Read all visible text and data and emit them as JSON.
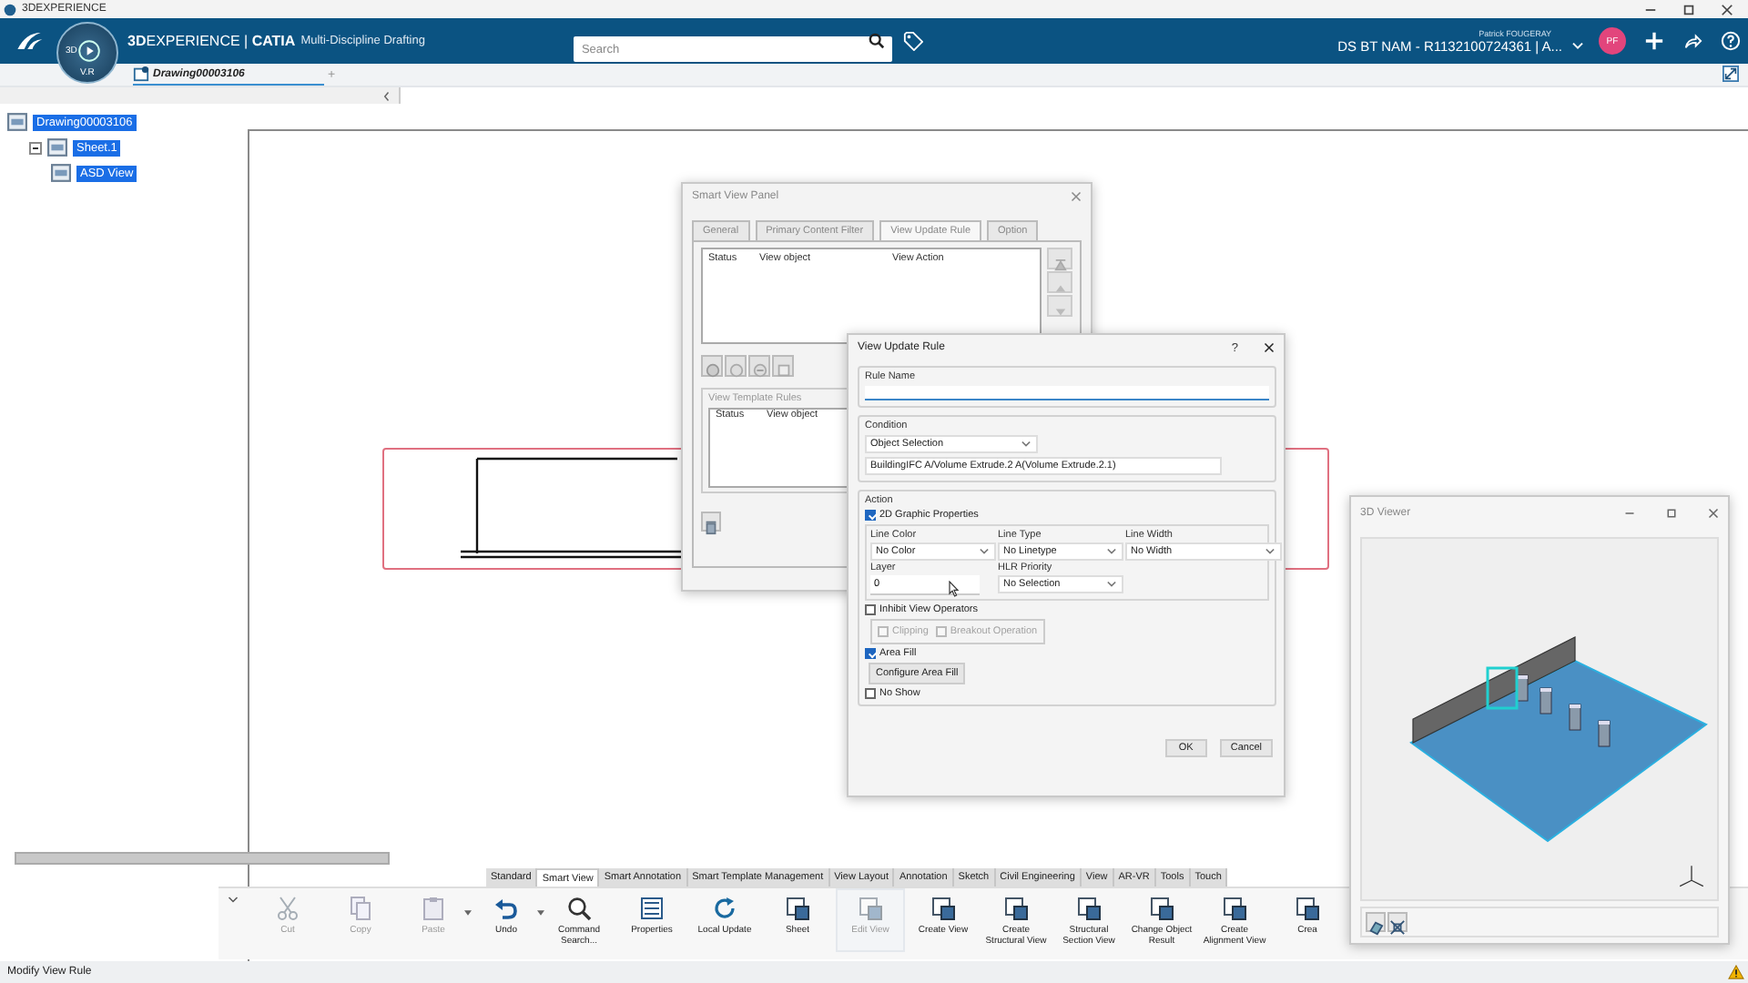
{
  "title_bar": {
    "title": "3DEXPERIENCE"
  },
  "top_bar": {
    "brand": "**3D**EXPERIENCE | **CATIA**",
    "role": "Multi-Discipline Drafting",
    "compass": [
      "3D",
      "V.R"
    ],
    "search": {
      "placeholder": "Search"
    },
    "user": "Patrick FOUGERAY",
    "tenant": "DS BT NAM - R1132100724361 | A...",
    "avatar": "PF"
  },
  "doc_tabs": [
    {
      "label": "Drawing00003106",
      "selected": true
    }
  ],
  "add_tab": "+",
  "tree": [
    {
      "label": "Drawing00003106",
      "selected": true,
      "children": [
        {
          "label": "Sheet.1",
          "selected": true,
          "expanded": true,
          "children": [
            {
              "label": "ASD View",
              "selected": true
            }
          ]
        }
      ]
    }
  ],
  "smart_view_panel": {
    "title": "Smart View Panel",
    "tabs": [
      {
        "label": "General",
        "selected": false
      },
      {
        "label": "Primary Content Filter",
        "selected": false
      },
      {
        "label": "View Update Rule",
        "selected": true
      },
      {
        "label": "Option",
        "selected": false
      }
    ],
    "rule_columns": [
      "Status",
      "View object",
      "View Action"
    ],
    "template_rules": {
      "title": "View Template Rules",
      "columns": [
        "Status",
        "View object"
      ]
    }
  },
  "rule_dialog": {
    "title": "View Update Rule",
    "help": "?",
    "rule_name": "Rule Name",
    "condition": {
      "title": "Condition",
      "selection": "Object Selection",
      "objects": "BuildingIFC A/Volume Extrude.2 A(Volume Extrude.2.1)"
    },
    "action": {
      "title": "Action",
      "graphic_properties": {
        "label": "2D Graphic Properties",
        "checked": true
      },
      "fields": [
        {
          "label": "Line Color",
          "kind": "dropdown",
          "value": "No Color"
        },
        {
          "label": "Line Type",
          "kind": "dropdown",
          "value": "No Linetype"
        },
        {
          "label": "Line Width",
          "kind": "dropdown",
          "value": "No Width"
        },
        {
          "label": "Layer",
          "kind": "input",
          "value": "0"
        },
        {
          "label": "HLR Priority",
          "kind": "dropdown",
          "value": "No Selection"
        }
      ],
      "inhibit": {
        "label": "Inhibit View Operators",
        "checked": false
      },
      "operators": [
        {
          "label": "Clipping",
          "checked": false,
          "disabled": true
        },
        {
          "label": "Breakout Operation",
          "checked": false,
          "disabled": true
        }
      ],
      "area_fill": {
        "label": "Area Fill",
        "checked": true
      },
      "configure_button": "Configure Area Fill",
      "no_show": {
        "label": "No Show",
        "checked": false
      }
    },
    "buttons": [
      "OK",
      "Cancel"
    ]
  },
  "viewer": {
    "title": "3D Viewer"
  },
  "toolbar": {
    "tabs": [
      {
        "label": "Standard",
        "selected": false
      },
      {
        "label": "Smart View",
        "selected": true
      },
      {
        "label": "Smart Annotation",
        "selected": false
      },
      {
        "label": "Smart Template Management",
        "selected": false
      },
      {
        "label": "View Layout",
        "selected": false
      },
      {
        "label": "Annotation",
        "selected": false
      },
      {
        "label": "Sketch",
        "selected": false
      },
      {
        "label": "Civil Engineering",
        "selected": false
      },
      {
        "label": "View",
        "selected": false
      },
      {
        "label": "AR-VR",
        "selected": false
      },
      {
        "label": "Tools",
        "selected": false
      },
      {
        "label": "Touch",
        "selected": false
      }
    ],
    "items": [
      {
        "label": "Cut",
        "kind": "scissors",
        "disabled": true,
        "selected": false,
        "has_menu": false
      },
      {
        "label": "Copy",
        "kind": "pages",
        "disabled": true,
        "selected": false,
        "has_menu": false
      },
      {
        "label": "Paste",
        "kind": "clipboard",
        "disabled": true,
        "selected": false,
        "has_menu": true
      },
      {
        "label": "Undo",
        "kind": "undo",
        "disabled": false,
        "selected": false,
        "has_menu": true
      },
      {
        "label": "Command Search...",
        "kind": "magnifier",
        "disabled": false,
        "selected": false,
        "has_menu": false
      },
      {
        "label": "Properties",
        "kind": "list",
        "disabled": false,
        "selected": false,
        "has_menu": false
      },
      {
        "label": "Local Update",
        "kind": "refresh",
        "disabled": false,
        "selected": false,
        "has_menu": false
      },
      {
        "label": "Sheet",
        "kind": "frame",
        "disabled": false,
        "selected": false,
        "has_menu": false
      },
      {
        "label": "Edit View",
        "kind": "frame",
        "disabled": true,
        "selected": true,
        "has_menu": false
      },
      {
        "label": "Create View",
        "kind": "frame",
        "disabled": false,
        "selected": false,
        "has_menu": false
      },
      {
        "label": "Create Structural View",
        "kind": "frame",
        "disabled": false,
        "selected": false,
        "has_menu": false
      },
      {
        "label": "Structural Section View",
        "kind": "frame",
        "disabled": false,
        "selected": false,
        "has_menu": false
      },
      {
        "label": "Change Object Result",
        "kind": "frame",
        "disabled": false,
        "selected": false,
        "has_menu": false
      },
      {
        "label": "Create Alignment View",
        "kind": "frame",
        "disabled": false,
        "selected": false,
        "has_menu": false
      },
      {
        "label": "Crea",
        "kind": "frame",
        "disabled": false,
        "selected": false,
        "has_menu": false
      }
    ]
  },
  "status_bar": {
    "text": "Modify View Rule"
  }
}
